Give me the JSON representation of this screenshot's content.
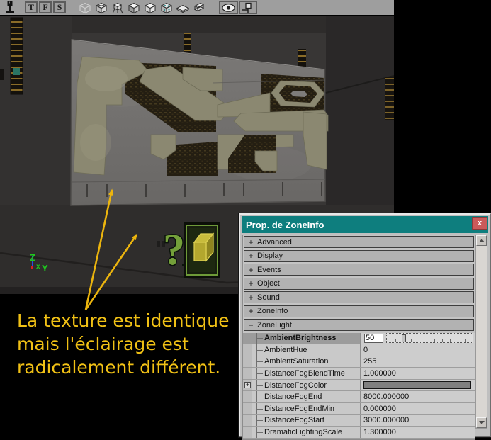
{
  "toolbar": {
    "letter_buttons": [
      {
        "label": "T"
      },
      {
        "label": "F"
      },
      {
        "label": "S"
      }
    ],
    "icon_names": [
      "actor-lever-icon",
      "wireframe-cube-icon",
      "zones-cube-icon",
      "bsp-tripod-cube-icon",
      "lit-cube-icon",
      "unlit-cube-icon",
      "textured-cube-icon",
      "flat-sheet-icon",
      "layered-sheets-icon",
      "eye-icon",
      "connector-icon"
    ]
  },
  "viewport": {
    "axis_labels": {
      "z": "Z",
      "x": "x",
      "y": "Y"
    },
    "sprite": "zoneinfo-question-mark-and-box"
  },
  "annotation": {
    "lines": [
      "La texture est identique",
      "mais l'éclairage est",
      "radicalement différent."
    ],
    "text_color": "#F1C115",
    "arrow_color": "#ECB50E"
  },
  "properties_window": {
    "title": "Prop. de ZoneInfo",
    "close_label": "x",
    "title_bar_color": "#0E7E7E",
    "categories": [
      {
        "label": "Advanced",
        "state": "+"
      },
      {
        "label": "Display",
        "state": "+"
      },
      {
        "label": "Events",
        "state": "+"
      },
      {
        "label": "Object",
        "state": "+"
      },
      {
        "label": "Sound",
        "state": "+"
      },
      {
        "label": "ZoneInfo",
        "state": "+"
      },
      {
        "label": "ZoneLight",
        "state": "−"
      }
    ],
    "zonelight_properties": [
      {
        "name": "AmbientBrightness",
        "value": "50",
        "selected": true,
        "editor": "slider"
      },
      {
        "name": "AmbientHue",
        "value": "0"
      },
      {
        "name": "AmbientSaturation",
        "value": "255"
      },
      {
        "name": "DistanceFogBlendTime",
        "value": "1.000000"
      },
      {
        "name": "DistanceFogColor",
        "value": "",
        "editor": "color",
        "swatch_color": "#7F7F7F",
        "expand_symbol": "+"
      },
      {
        "name": "DistanceFogEnd",
        "value": "8000.000000"
      },
      {
        "name": "DistanceFogEndMin",
        "value": "0.000000"
      },
      {
        "name": "DistanceFogStart",
        "value": "3000.000000"
      },
      {
        "name": "DramaticLightingScale",
        "value": "1.300000",
        "clipped": true
      }
    ]
  }
}
